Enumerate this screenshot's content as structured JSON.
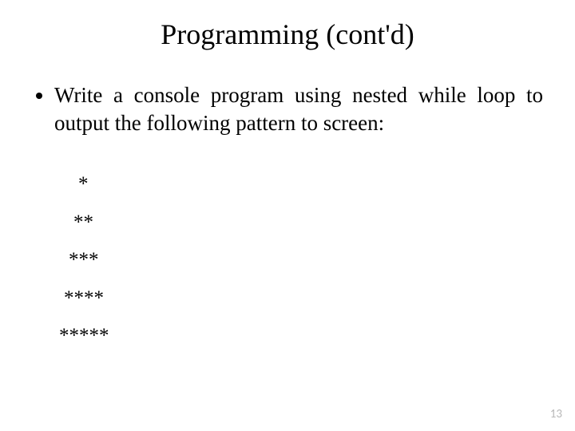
{
  "title": "Programming (cont'd)",
  "bullet": "Write a console program using nested while loop to output the following pattern to screen:",
  "pattern": {
    "r1": "*",
    "r2": "**",
    "r3": "***",
    "r4": "****",
    "r5": "*****"
  },
  "page_number": "13"
}
